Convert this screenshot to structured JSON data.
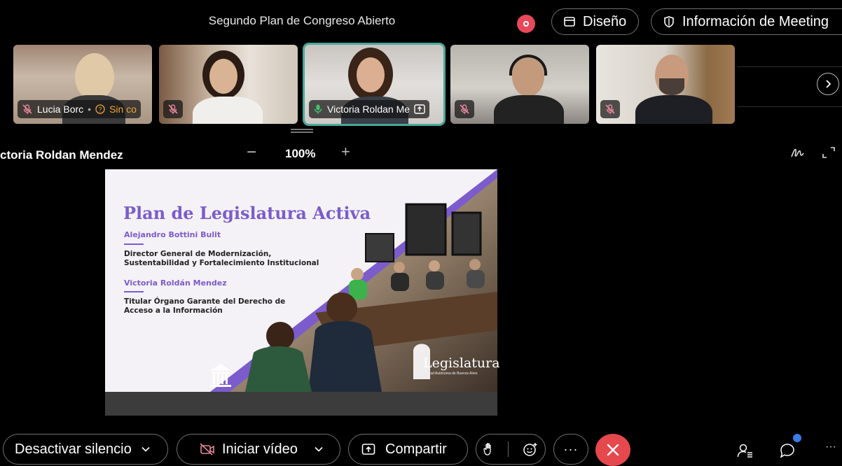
{
  "header": {
    "meeting_title": "Segundo Plan de Congreso Abierto",
    "layout_label": "Diseño",
    "info_label": "Información de Meeting"
  },
  "participants": [
    {
      "name": "Lucia Borc",
      "status": "Sin co",
      "muted": true
    },
    {
      "name": "",
      "muted": true
    },
    {
      "name": "Victoria Roldan Me",
      "muted": false,
      "active": true
    },
    {
      "name": "",
      "muted": true
    },
    {
      "name": "",
      "muted": true
    }
  ],
  "share": {
    "sharer_name": "ctoria Roldan Mendez",
    "zoom_minus": "−",
    "zoom_level": "100%",
    "zoom_plus": "+"
  },
  "slide": {
    "title": "Plan de Legislatura Activa",
    "person1_name": "Alejandro Bottini Bulit",
    "person1_role_line1": "Director General de Modernización,",
    "person1_role_line2": "Sustentabilidad y Fortalecimiento Institucional",
    "person2_name": "Victoria Roldán Mendez",
    "person2_role_line1": "Titular Órgano Garante del Derecho de",
    "person2_role_line2": "Acceso a la Información",
    "logo_text": "Legislatura",
    "logo_subtext": "Ciudad Autónoma de Buenos Aires",
    "accent_color": "#7c5ccc"
  },
  "controls": {
    "unmute_label": "Desactivar silencio",
    "video_label": "Iniciar vídeo",
    "share_label": "Compartir",
    "more_label": "···"
  },
  "colors": {
    "record": "#e8495a",
    "hangup": "#e5484d",
    "active_border": "#47a89b",
    "warning": "#f2a43a",
    "notification": "#3b7be8"
  }
}
